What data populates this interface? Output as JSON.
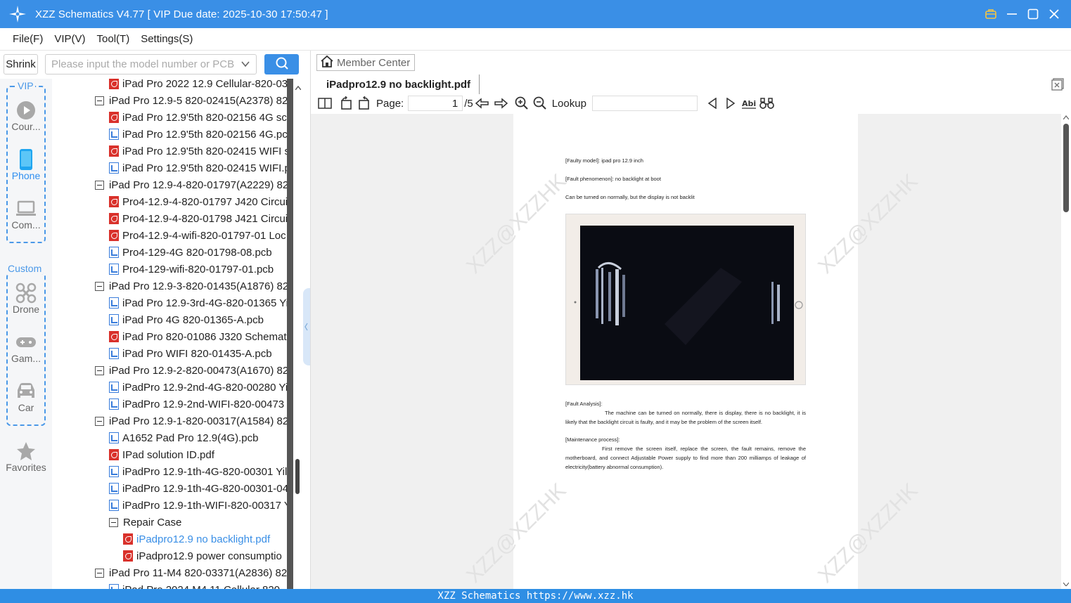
{
  "window": {
    "title": "XZZ Schematics V4.77 [ VIP Due date: 2025-10-30 17:50:47 ]"
  },
  "menu": {
    "items": [
      "File(F)",
      "VIP(V)",
      "Tool(T)",
      "Settings(S)"
    ]
  },
  "search": {
    "shrink_label": "Shrink",
    "placeholder": "Please input the model number or PCB"
  },
  "nav": {
    "vip_group_label": "VIP",
    "custom_group_label": "Custom",
    "items": [
      {
        "label": "Cour...",
        "icon": "play-circle-icon"
      },
      {
        "label": "Phone",
        "icon": "phone-icon",
        "active": true
      },
      {
        "label": "Com...",
        "icon": "laptop-icon"
      },
      {
        "label": "Drone",
        "icon": "drone-icon"
      },
      {
        "label": "Gam...",
        "icon": "gamepad-icon"
      },
      {
        "label": "Car",
        "icon": "car-icon"
      },
      {
        "label": "Favorites",
        "icon": "star-icon"
      }
    ]
  },
  "tree": {
    "rows": [
      {
        "label": "iPad Pro 2022 12.9 Cellular-820-03",
        "type": "pdf",
        "depth": 1
      },
      {
        "label": "iPad Pro 12.9-5 820-02415(A2378) 820",
        "type": "folder",
        "depth": 0
      },
      {
        "label": "iPad Pro 12.9'5th 820-02156 4G sch",
        "type": "pdf",
        "depth": 1
      },
      {
        "label": "iPad Pro 12.9'5th 820-02156 4G.pcb",
        "type": "pcb",
        "depth": 1
      },
      {
        "label": "iPad Pro 12.9'5th 820-02415 WIFI s",
        "type": "pdf",
        "depth": 1
      },
      {
        "label": "iPad Pro 12.9'5th 820-02415 WIFI.p",
        "type": "pcb",
        "depth": 1
      },
      {
        "label": "iPad Pro 12.9-4-820-01797(A2229) 82",
        "type": "folder",
        "depth": 0
      },
      {
        "label": "Pro4-12.9-4-820-01797 J420 Circuit",
        "type": "pdf",
        "depth": 1
      },
      {
        "label": "Pro4-12.9-4-820-01798 J421 Circuit",
        "type": "pdf",
        "depth": 1
      },
      {
        "label": "Pro4-12.9-4-wifi-820-01797-01 Loc",
        "type": "pdf",
        "depth": 1
      },
      {
        "label": "Pro4-129-4G 820-01798-08.pcb",
        "type": "pcb",
        "depth": 1
      },
      {
        "label": "Pro4-129-wifi-820-01797-01.pcb",
        "type": "pcb",
        "depth": 1
      },
      {
        "label": "iPad Pro 12.9-3-820-01435(A1876) 82",
        "type": "folder",
        "depth": 0
      },
      {
        "label": "iPad Pro 12.9-3rd-4G-820-01365 Yi",
        "type": "pcb",
        "depth": 1
      },
      {
        "label": "iPad Pro 4G 820-01365-A.pcb",
        "type": "pcb",
        "depth": 1
      },
      {
        "label": "iPad Pro 820-01086 J320 Schemati",
        "type": "pdf",
        "depth": 1
      },
      {
        "label": "iPad Pro WIFI 820-01435-A.pcb",
        "type": "pcb",
        "depth": 1
      },
      {
        "label": "iPad Pro 12.9-2-820-00473(A1670) 82",
        "type": "folder",
        "depth": 0
      },
      {
        "label": "iPadPro 12.9-2nd-4G-820-00280 Yi",
        "type": "pcb",
        "depth": 1
      },
      {
        "label": "iPadPro 12.9-2nd-WIFI-820-00473",
        "type": "pcb",
        "depth": 1
      },
      {
        "label": "iPad Pro 12.9-1-820-00317(A1584) 82",
        "type": "folder",
        "depth": 0
      },
      {
        "label": "A1652 Pad Pro 12.9(4G).pcb",
        "type": "pcb",
        "depth": 1
      },
      {
        "label": "IPad solution ID.pdf",
        "type": "pdf",
        "depth": 1
      },
      {
        "label": "iPadPro 12.9-1th-4G-820-00301 Yil",
        "type": "pcb",
        "depth": 1
      },
      {
        "label": "iPadPro 12.9-1th-4G-820-00301-04",
        "type": "pcb",
        "depth": 1
      },
      {
        "label": "iPadPro 12.9-1th-WIFI-820-00317 Y",
        "type": "pcb",
        "depth": 1
      },
      {
        "label": "Repair Case",
        "type": "folder",
        "depth": 1
      },
      {
        "label": "iPadpro12.9 no backlight.pdf",
        "type": "pdf",
        "depth": 2,
        "selected": true
      },
      {
        "label": "iPadpro12.9 power consumptio",
        "type": "pdf",
        "depth": 2
      },
      {
        "label": "iPad Pro 11-M4 820-03371(A2836) 82",
        "type": "folder",
        "depth": 0
      },
      {
        "label": "iPad Pro 2024 M4 11 Cellular 820",
        "type": "pcb",
        "depth": 1
      }
    ]
  },
  "viewer": {
    "member_center_label": "Member Center",
    "tab_title": "iPadpro12.9 no backlight.pdf",
    "page_label": "Page:",
    "page_current": "1",
    "page_total": "/5",
    "lookup_label": "Lookup",
    "lookup_value": ""
  },
  "document": {
    "line1": "[Faulty model]: ipad pro 12.9 inch",
    "line2": "[Fault phenomenon]: no backlight at boot",
    "line3": "Can be turned on normally, but the display is not backlit",
    "analysis_heading": "[Fault Analysis]:",
    "analysis_body": "The machine can be turned on normally, there is display, there is no backlight, it is likely that the backlight circuit is faulty, and it may be the problem of the screen itself.",
    "maintenance_heading": "[Maintenance process]:",
    "maintenance_body": "First remove the screen itself, replace the screen, the fault remains, remove the motherboard, and connect Adjustable Power supply to find more than 200 milliamps of leakage of electricity(battery abnormal consumption).",
    "watermark": "XZZ@XZZHK"
  },
  "status": {
    "text": "XZZ Schematics https://www.xzz.hk"
  },
  "colors": {
    "accent": "#3a8fe6",
    "status_bar": "#2f8ee4",
    "pdf_icon": "#d9312b",
    "pcb_icon": "#3a7ddb"
  }
}
